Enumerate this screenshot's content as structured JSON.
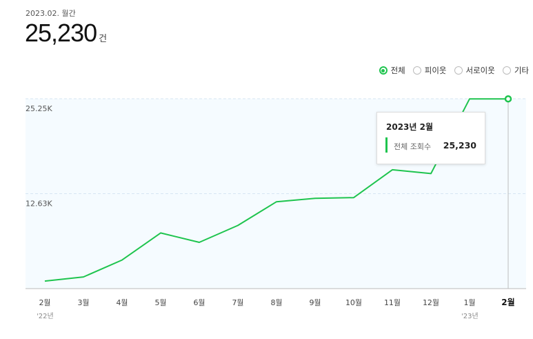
{
  "header": {
    "period": "2023.02. 월간",
    "total": "25,230",
    "unit": "건"
  },
  "filters": [
    {
      "label": "전체",
      "selected": true
    },
    {
      "label": "피이웃",
      "selected": false
    },
    {
      "label": "서로이웃",
      "selected": false
    },
    {
      "label": "기타",
      "selected": false
    }
  ],
  "tooltip": {
    "title": "2023년 2월",
    "label": "전체 조회수",
    "value": "25,230"
  },
  "colors": {
    "line": "#1ec44e",
    "plot_bg": "#f5fbff",
    "grid": "#d6e6f2"
  },
  "chart_data": {
    "type": "line",
    "categories": [
      "2월",
      "3월",
      "4월",
      "5월",
      "6월",
      "7월",
      "8월",
      "9월",
      "10월",
      "11월",
      "12월",
      "1월",
      "2월"
    ],
    "year_labels": [
      {
        "index": 0,
        "label": "'22년"
      },
      {
        "index": 11,
        "label": "'23년"
      }
    ],
    "highlight_index": 12,
    "y_ticks": [
      {
        "value": 12630,
        "label": "12.63K"
      },
      {
        "value": 25250,
        "label": "25.25K"
      }
    ],
    "ylim": [
      0,
      25250
    ],
    "series": [
      {
        "values": [
          1000,
          1550,
          3800,
          7400,
          6150,
          8400,
          11550,
          12000,
          12100,
          15800,
          15300,
          25230,
          25230
        ]
      }
    ],
    "grid": true
  }
}
